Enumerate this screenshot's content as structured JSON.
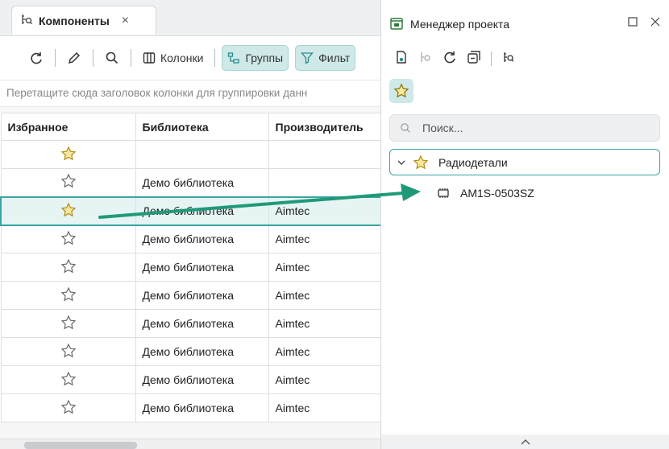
{
  "left_panel": {
    "tab": {
      "label": "Компоненты",
      "close": "×"
    },
    "toolbar": {
      "columns_label": "Колонки",
      "groups_label": "Группы",
      "filter_label": "Фильт"
    },
    "group_hint": "Перетащите сюда заголовок колонки для группировки данн",
    "table": {
      "headers": [
        "Избранное",
        "Библиотека",
        "Производитель"
      ],
      "rows": [
        {
          "library": "",
          "manufacturer": ""
        },
        {
          "library": "Демо библиотека",
          "manufacturer": ""
        },
        {
          "library": "Демо библиотека",
          "manufacturer": "Aimtec",
          "selected": true
        },
        {
          "library": "Демо библиотека",
          "manufacturer": "Aimtec"
        },
        {
          "library": "Демо библиотека",
          "manufacturer": "Aimtec"
        },
        {
          "library": "Демо библиотека",
          "manufacturer": "Aimtec"
        },
        {
          "library": "Демо библиотека",
          "manufacturer": "Aimtec"
        },
        {
          "library": "Демо библиотека",
          "manufacturer": "Aimtec"
        },
        {
          "library": "Демо библиотека",
          "manufacturer": "Aimtec"
        },
        {
          "library": "Демо библиотека",
          "manufacturer": "Aimtec"
        }
      ]
    }
  },
  "right_panel": {
    "title": "Менеджер проекта",
    "search_placeholder": "Поиск...",
    "tree": {
      "folder": "Радиодетали",
      "child": "AM1S-0503SZ"
    },
    "bottom_chevron": "^"
  },
  "colors": {
    "accent": "#3aa3a3",
    "star": "#c9a227",
    "arrow": "#1f9a78"
  }
}
